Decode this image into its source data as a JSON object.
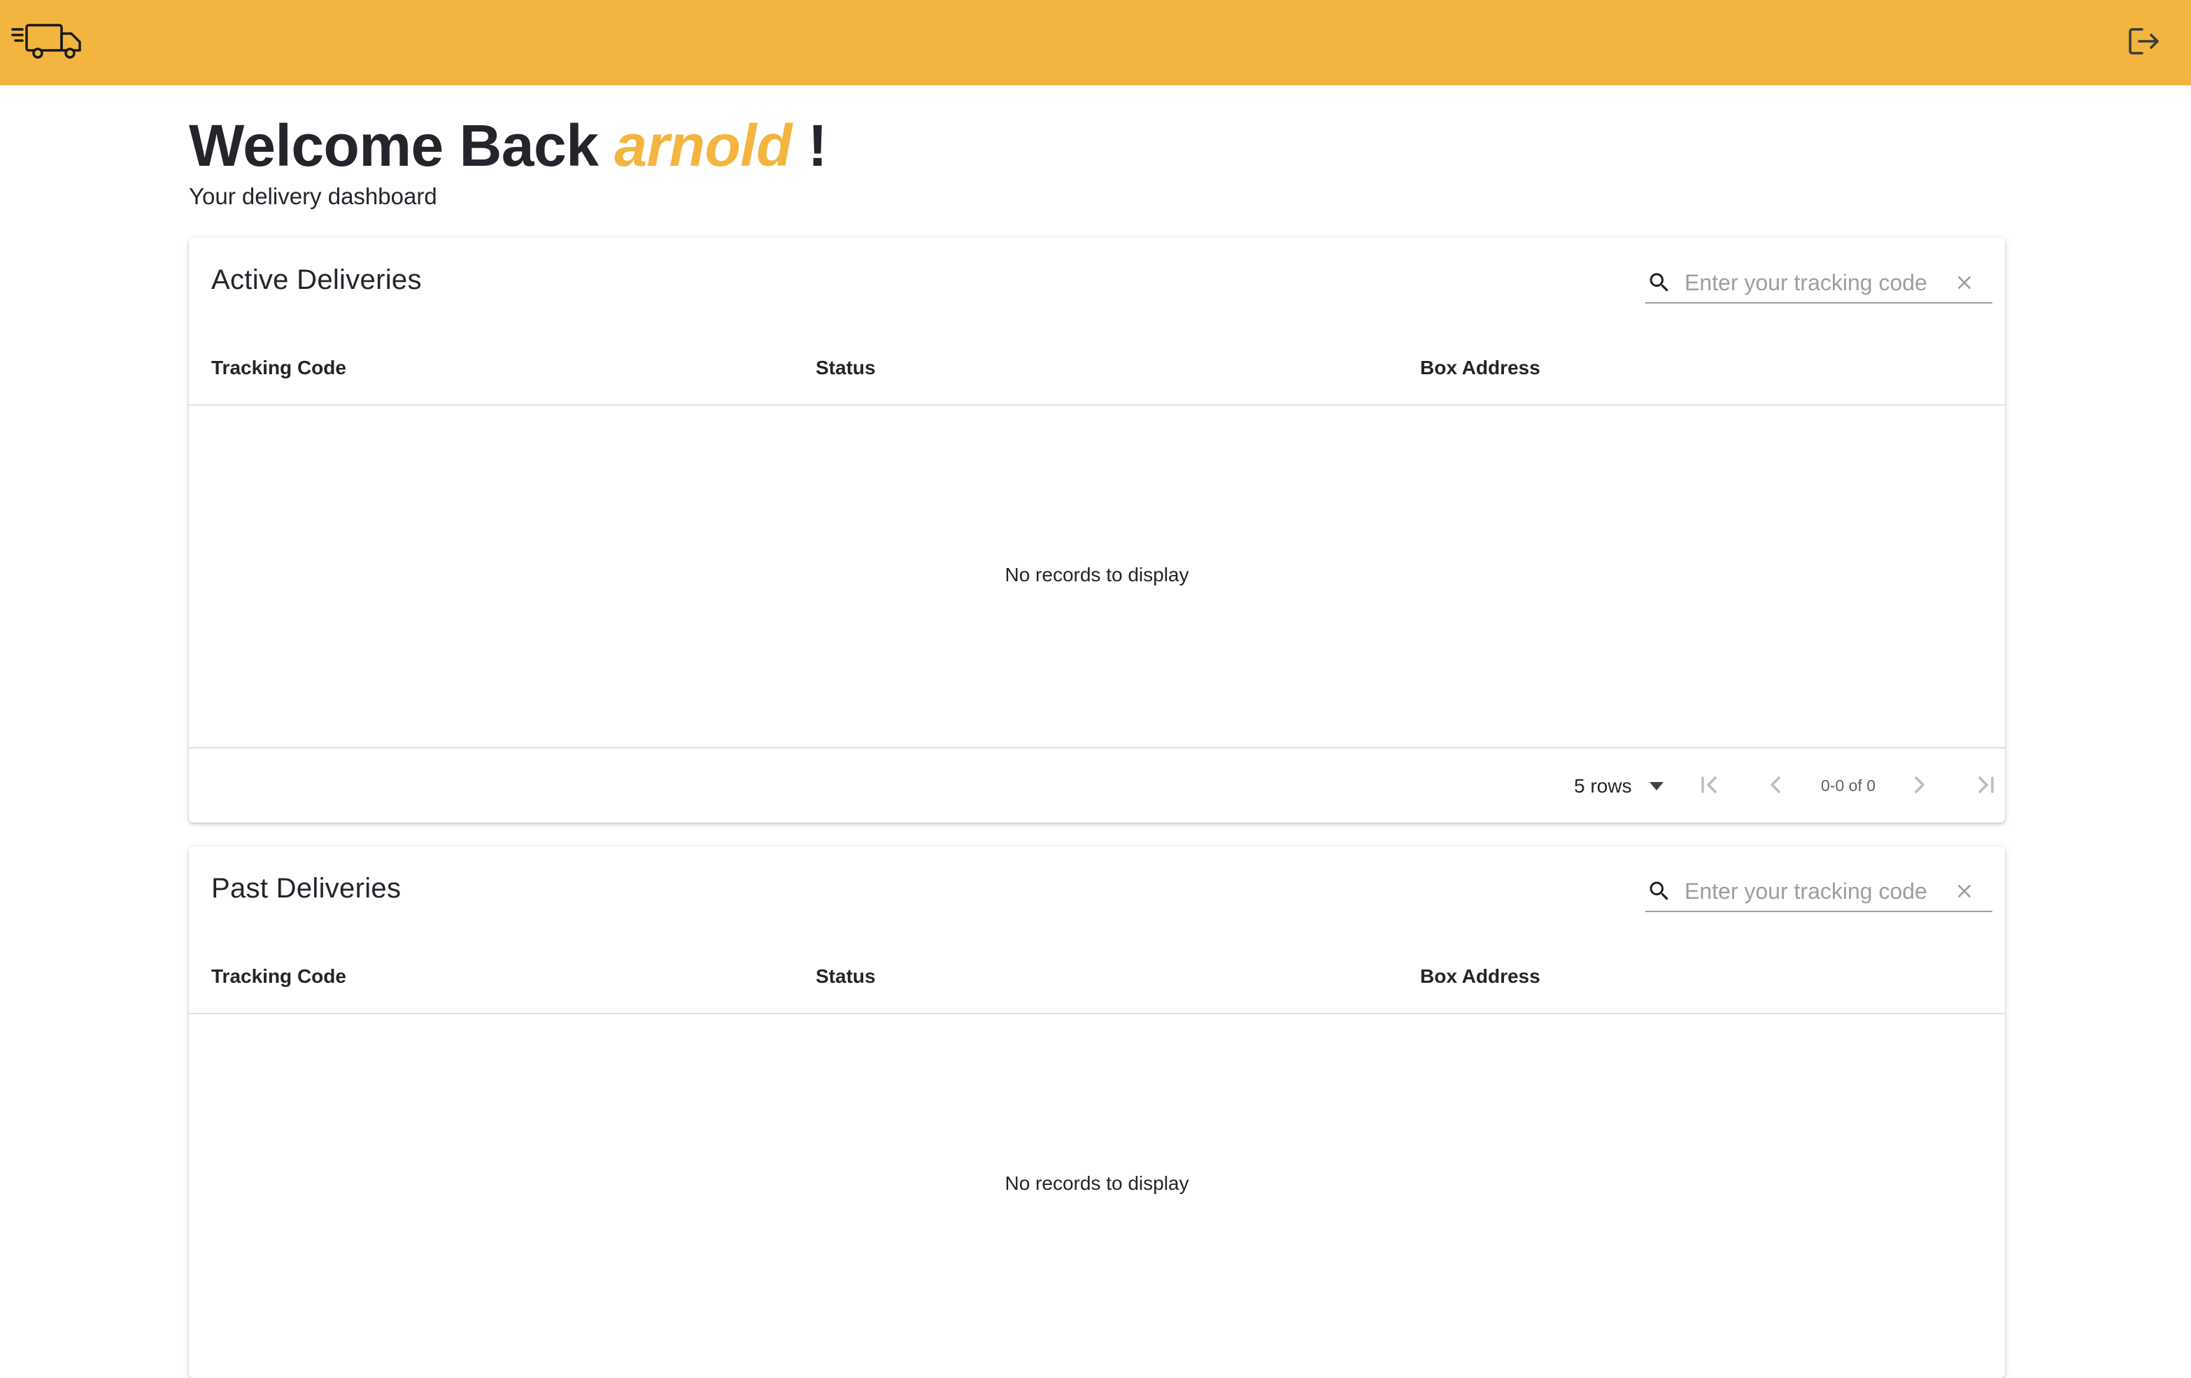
{
  "header": {
    "logo_icon": "delivery-truck-icon",
    "logout_icon": "logout-icon",
    "background_color": "#f3b540"
  },
  "welcome": {
    "prefix": "Welcome Back",
    "username": "arnold",
    "suffix": "!",
    "subtitle": "Your delivery dashboard",
    "accent_color": "#f3b540"
  },
  "active_deliveries": {
    "title": "Active Deliveries",
    "search_placeholder": "Enter your tracking code",
    "search_value": "",
    "columns": [
      "Tracking Code",
      "Status",
      "Box Address"
    ],
    "rows": [],
    "empty_message": "No records to display",
    "pagination": {
      "rows_label": "5 rows",
      "info": "0-0 of 0"
    }
  },
  "past_deliveries": {
    "title": "Past Deliveries",
    "search_placeholder": "Enter your tracking code",
    "search_value": "",
    "columns": [
      "Tracking Code",
      "Status",
      "Box Address"
    ],
    "rows": [],
    "empty_message": "No records to display"
  }
}
